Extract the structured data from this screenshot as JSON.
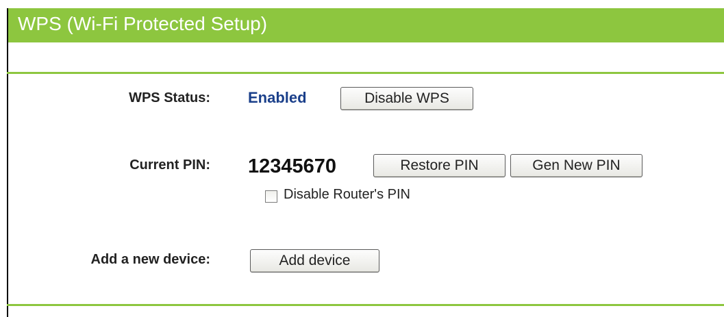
{
  "header": {
    "title": "WPS (Wi-Fi Protected Setup)"
  },
  "wps_status": {
    "label": "WPS Status:",
    "value": "Enabled",
    "button_label": "Disable WPS"
  },
  "current_pin": {
    "label": "Current PIN:",
    "value": "12345670",
    "restore_button_label": "Restore PIN",
    "gen_button_label": "Gen New PIN",
    "disable_checkbox_label": "Disable Router's PIN",
    "disable_checkbox_checked": false
  },
  "add_device": {
    "label": "Add a new device:",
    "button_label": "Add device"
  },
  "colors": {
    "header_green": "#8dc63f",
    "status_blue": "#1a3f8a"
  }
}
